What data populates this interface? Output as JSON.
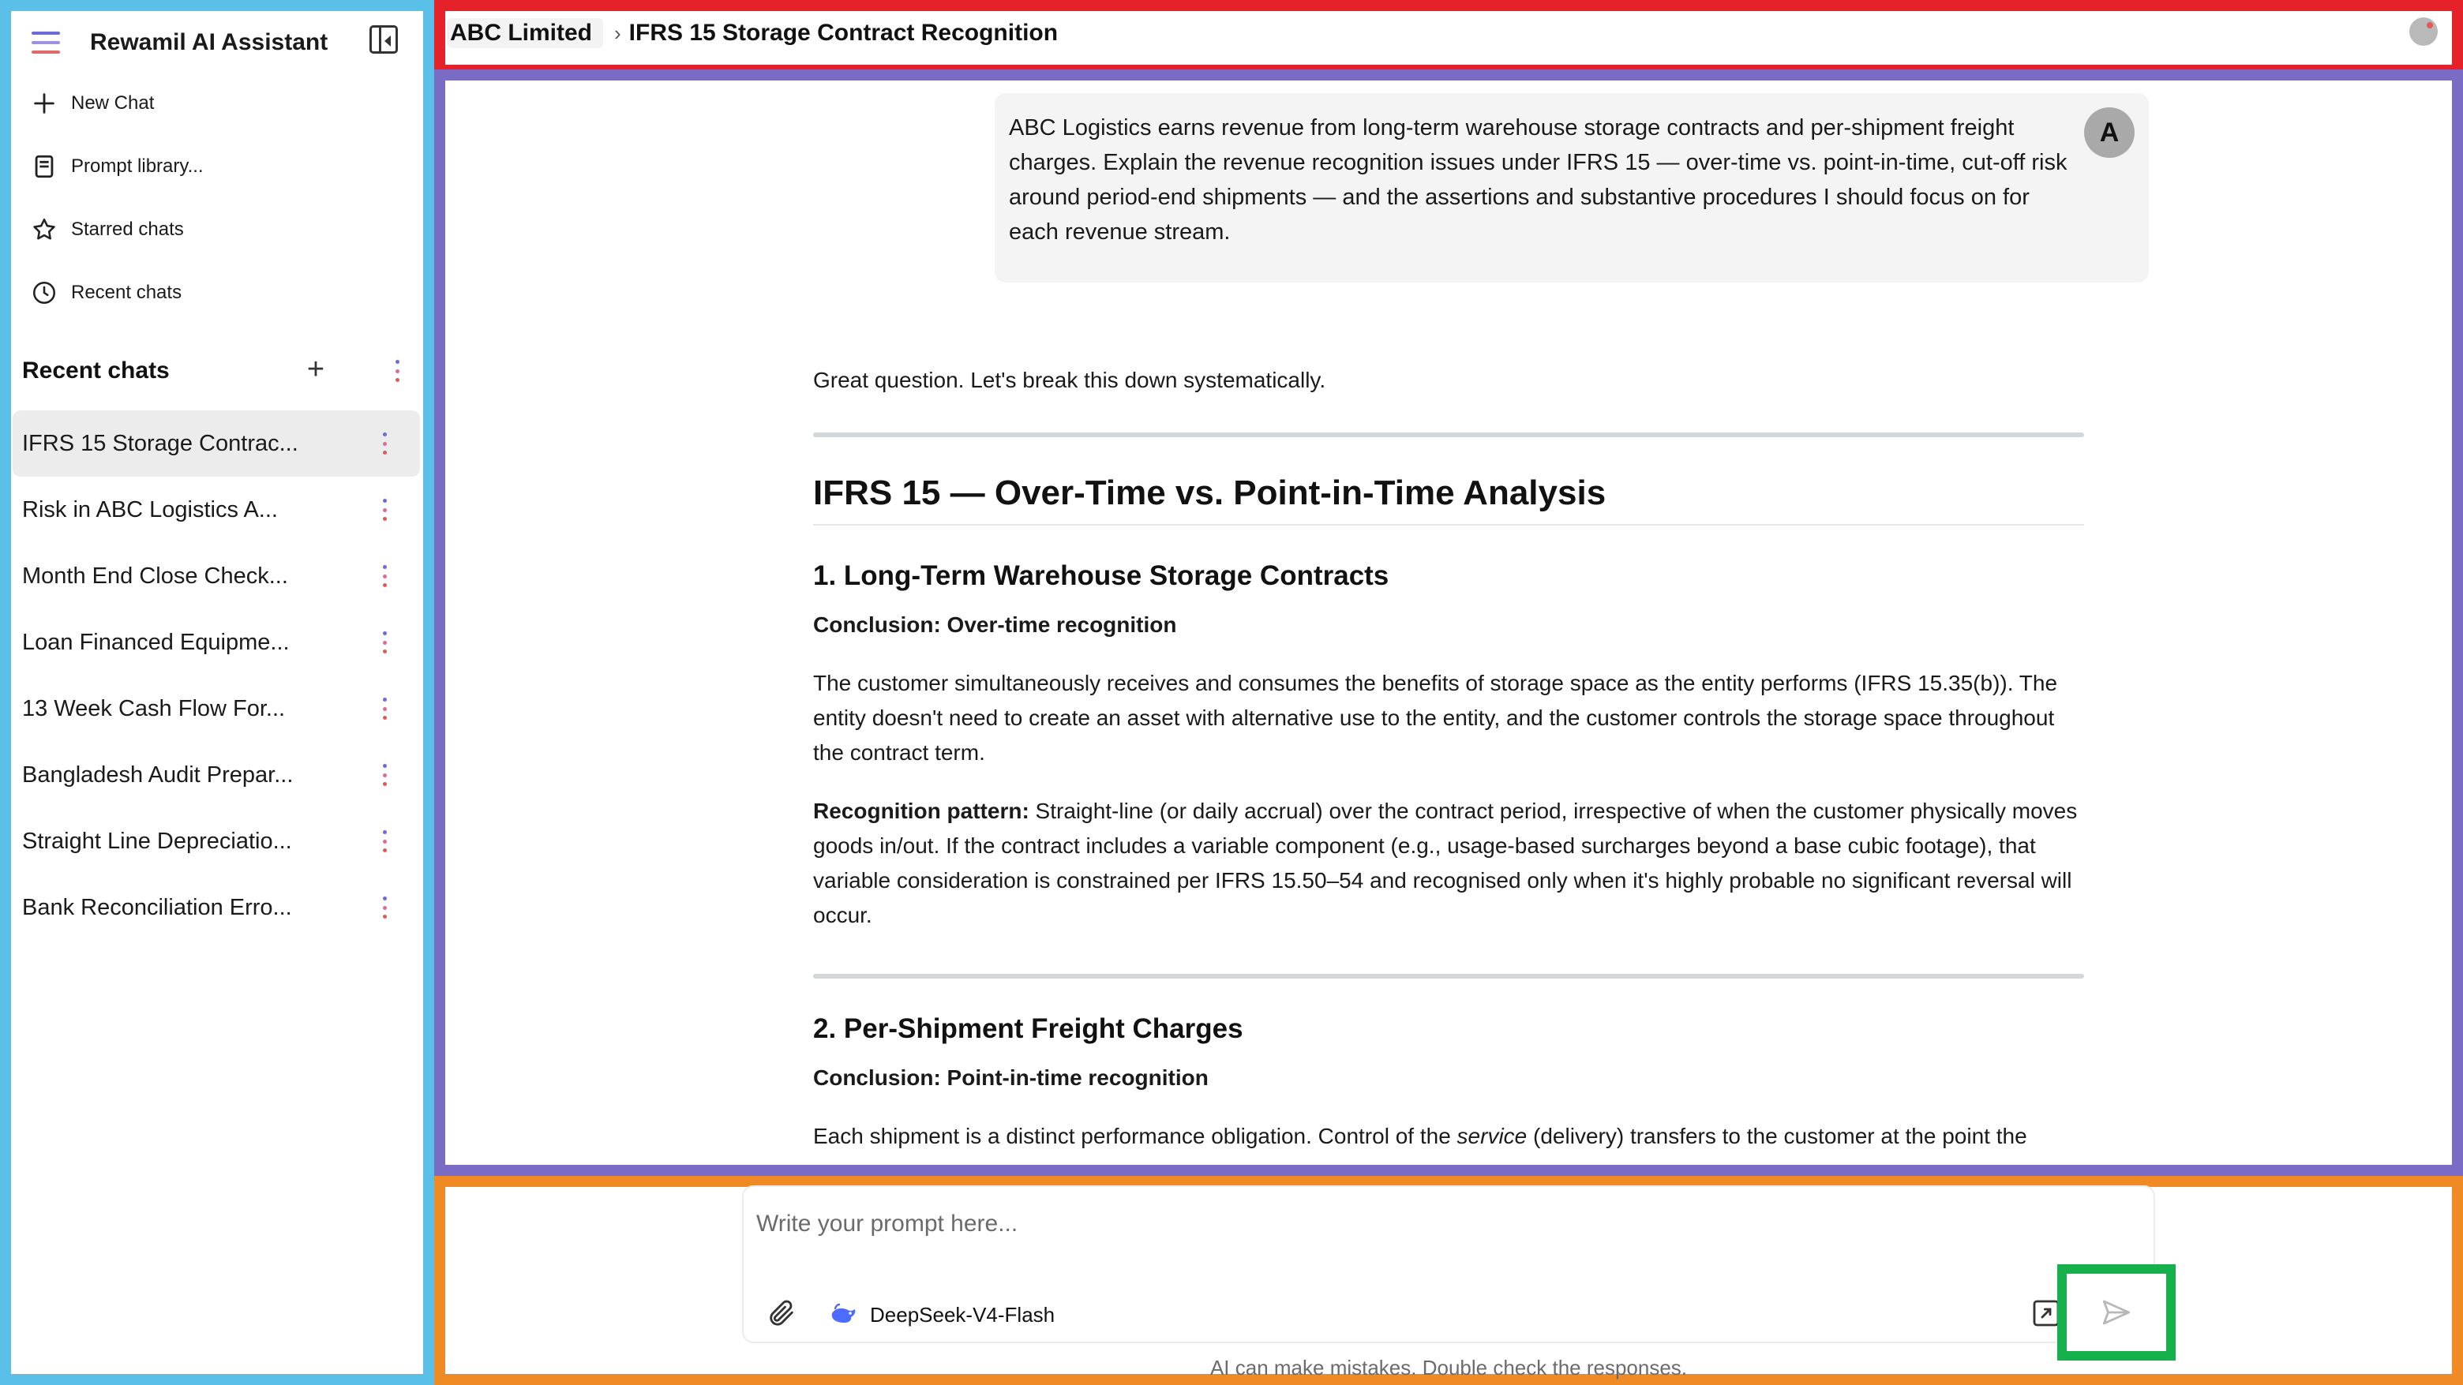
{
  "app": {
    "title": "Rewamil AI Assistant"
  },
  "sidebar": {
    "nav": [
      {
        "label": "New Chat",
        "icon": "plus-icon"
      },
      {
        "label": "Prompt library...",
        "icon": "book-icon"
      },
      {
        "label": "Starred chats",
        "icon": "star-icon"
      },
      {
        "label": "Recent chats",
        "icon": "clock-icon"
      }
    ],
    "recent_header": "Recent chats",
    "recent_chats": [
      "IFRS 15 Storage Contrac...",
      "Risk in ABC Logistics A...",
      "Month End Close Check...",
      "Loan Financed Equipme...",
      "13 Week Cash Flow For...",
      "Bangladesh Audit Prepar...",
      "Straight Line Depreciatio...",
      "Bank Reconciliation Erro..."
    ]
  },
  "header": {
    "organization": "ABC Limited",
    "separator": "›",
    "chat_title": "IFRS 15 Storage Contract Recognition"
  },
  "conversation": {
    "user_avatar_initial": "A",
    "user_message": "ABC Logistics earns revenue from long-term warehouse storage contracts and per-shipment freight charges. Explain the revenue recognition issues under IFRS 15 — over-time vs. point-in-time, cut-off risk around period-end shipments — and the assertions and substantive procedures I should focus on for each revenue stream.",
    "assistant": {
      "intro": "Great question. Let's break this down systematically.",
      "heading": "IFRS 15 — Over-Time vs. Point-in-Time Analysis",
      "section1": {
        "title": "1. Long-Term Warehouse Storage Contracts",
        "conclusion": "Conclusion: Over-time recognition",
        "body": "The customer simultaneously receives and consumes the benefits of storage space as the entity performs (IFRS 15.35(b)). The entity doesn't need to create an asset with alternative use to the entity, and the customer controls the storage space throughout the contract term.",
        "pattern_label": "Recognition pattern:",
        "pattern_body": " Straight-line (or daily accrual) over the contract period, irrespective of when the customer physically moves goods in/out. If the contract includes a variable component (e.g., usage-based surcharges beyond a base cubic footage), that variable consideration is constrained per IFRS 15.50–54 and recognised only when it's highly probable no significant reversal will occur."
      },
      "section2": {
        "title": "2. Per-Shipment Freight Charges",
        "conclusion": "Conclusion: Point-in-time recognition",
        "body_start": "Each shipment is a distinct performance obligation. Control of the ",
        "body_em": "service",
        "body_end": " (delivery) transfers to the customer at the point the"
      }
    }
  },
  "composer": {
    "placeholder": "Write your prompt here...",
    "model": "DeepSeek-V4-Flash",
    "disclaimer": "AI can make mistakes. Double check the responses."
  },
  "colors": {
    "sidebar_frame": "#5bc0e8",
    "header_frame": "#e52129",
    "conversation_frame": "#7a6cc4",
    "composer_frame": "#f08a24",
    "send_frame": "#16b14d",
    "model_logo": "#4d6bfe"
  }
}
